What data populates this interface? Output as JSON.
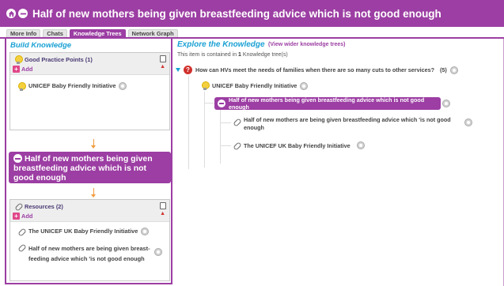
{
  "header": {
    "title": "Half of new mothers being given breastfeeding advice which is not good enough",
    "home_icon": "home-icon",
    "issue_icon": "issue-icon",
    "color": "#9c3ea3"
  },
  "tabs": [
    {
      "label": "More Info",
      "active": false
    },
    {
      "label": "Chats",
      "active": false
    },
    {
      "label": "Knowledge Trees",
      "active": true
    },
    {
      "label": "Network Graph",
      "active": false
    }
  ],
  "build": {
    "title": "Build Knowledge",
    "good_practice": {
      "title": "Good Practice Points (1)",
      "add_label": "Add",
      "items": [
        "UNICEF Baby Friendly Initiative"
      ]
    },
    "focal": "Half of new mothers being given breastfeeding advice which is not good enough",
    "resources": {
      "title": "Resources (2)",
      "add_label": "Add",
      "items": [
        "The UNICEF UK Baby Friendly Initiative",
        "Half of new mothers are being given breast-feeding advice which 'is not good enough"
      ]
    }
  },
  "explore": {
    "title": "Explore the Knowledge",
    "wider_link": "(View wider knowledge trees)",
    "contained_prefix": "This item is contained in",
    "contained_count": "1",
    "contained_suffix": "Knowledge tree(s)",
    "tree": {
      "question": "How can HVs meet the needs of families when there are so many cuts to other services?",
      "question_count": "(5)",
      "good_practice": "UNICEF Baby Friendly Initiative",
      "focal": "Half of new mothers being given breastfeeding advice which is not good enough",
      "resources": [
        "Half of new mothers are being given breastfeeding advice which 'is not good enough",
        "The UNICEF UK Baby Friendly Initiative"
      ]
    }
  },
  "colors": {
    "accent": "#9c3ea3",
    "heading": "#1ba1d4",
    "add": "#e0478a",
    "arrow": "#f29b3a"
  }
}
